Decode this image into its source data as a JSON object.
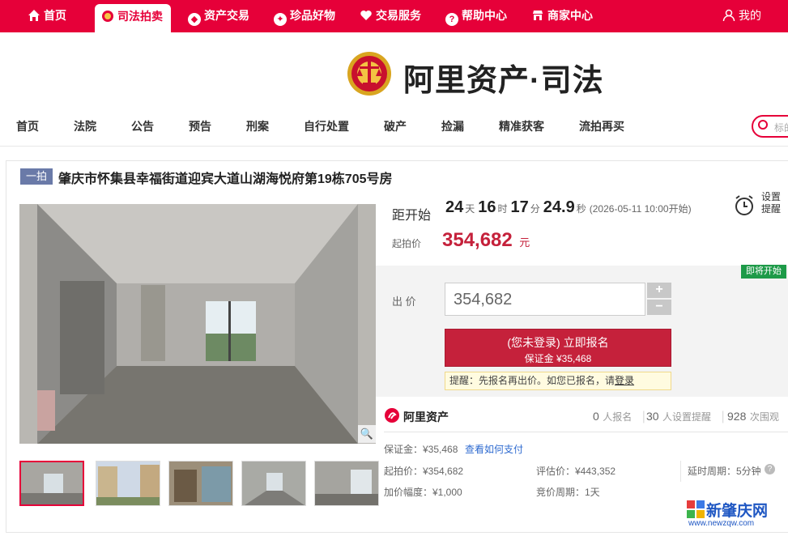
{
  "topnav": {
    "items": [
      {
        "label": "首页",
        "icon": "home-icon"
      },
      {
        "label": "司法拍卖",
        "icon": "court-emblem-icon",
        "active": true
      },
      {
        "label": "资产交易",
        "icon": "asset-icon"
      },
      {
        "label": "珍品好物",
        "icon": "treasure-icon"
      },
      {
        "label": "交易服务",
        "icon": "heart-icon"
      },
      {
        "label": "帮助中心",
        "icon": "help-icon"
      },
      {
        "label": "商家中心",
        "icon": "shop-icon"
      }
    ],
    "account": "我的",
    "accent": "#e60039"
  },
  "brand": {
    "name": "阿里资产·司法"
  },
  "catnav": [
    "首页",
    "法院",
    "公告",
    "预告",
    "刑案",
    "自行处置",
    "破产",
    "捡漏",
    "精准获客",
    "流拍再买"
  ],
  "search": {
    "placeholder": "标的"
  },
  "listing": {
    "round_tag": "一拍",
    "title": "肇庆市怀集县幸福街道迎宾大道山湖海悦府第19栋705号房",
    "countdown": {
      "label": "距开始",
      "days": "24",
      "days_unit": "天",
      "hours": "16",
      "hours_unit": "时",
      "minutes": "17",
      "minutes_unit": "分",
      "seconds": "24.9",
      "seconds_unit": "秒",
      "start_note": "(2026-05-11 10:00开始)"
    },
    "reminder": {
      "line1": "设置",
      "line2": "提醒"
    },
    "start_price_label": "起拍价",
    "start_price": "354,682",
    "price_unit": "元",
    "badge": "即将开始",
    "bid_label": "出 价",
    "bid_value": "354,682",
    "register_button": {
      "line1": "(您未登录) 立即报名",
      "line2": "保证金 ¥35,468"
    },
    "hint": {
      "text": "提醒：先报名再出价。如您已报名，请",
      "link": "登录"
    },
    "platform": "阿里资产",
    "stats": {
      "signup_count": "0",
      "signup_label": "人报名",
      "remind_count": "30",
      "remind_label": "人设置提醒",
      "views_count": "928",
      "views_label": "次围观"
    },
    "details": {
      "deposit": "保证金：¥35,468",
      "pay_link": "查看如何支付",
      "start_price": "起拍价：¥354,682",
      "appraisal": "评估价：¥443,352",
      "delay_period": "延时周期：5分钟",
      "increment": "加价幅度：¥1,000",
      "bid_cycle": "竞价周期：1天"
    }
  },
  "watermark": {
    "name": "新肇庆网",
    "url": "www.newzqw.com"
  }
}
